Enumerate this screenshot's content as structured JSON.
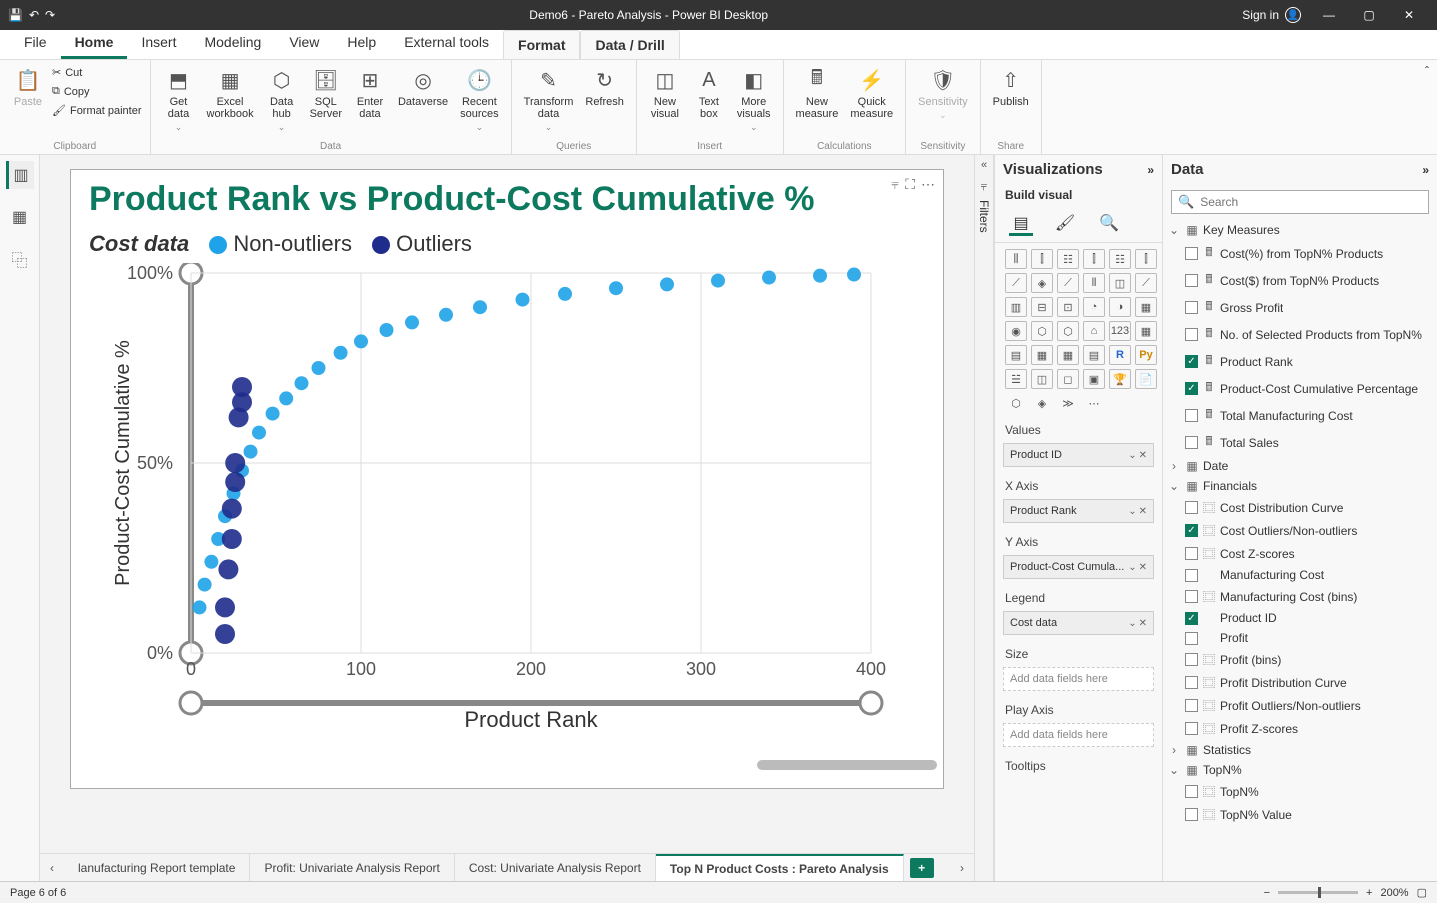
{
  "title": "Demo6 - Pareto Analysis - Power BI Desktop",
  "signin": "Sign in",
  "menutabs": [
    "File",
    "Home",
    "Insert",
    "Modeling",
    "View",
    "Help",
    "External tools",
    "Format",
    "Data / Drill"
  ],
  "activeMenu": 1,
  "selMenus": [
    7,
    8
  ],
  "ribbon": {
    "clipboard": {
      "title": "Clipboard",
      "paste": "Paste",
      "cut": "Cut",
      "copy": "Copy",
      "fmtpainter": "Format painter"
    },
    "data": {
      "title": "Data",
      "getdata": "Get\ndata",
      "excel": "Excel\nworkbook",
      "hub": "Data\nhub",
      "sql": "SQL\nServer",
      "enter": "Enter\ndata",
      "dataverse": "Dataverse",
      "recent": "Recent\nsources"
    },
    "queries": {
      "title": "Queries",
      "transform": "Transform\ndata",
      "refresh": "Refresh"
    },
    "insert": {
      "title": "Insert",
      "newvis": "New\nvisual",
      "textbox": "Text\nbox",
      "morevis": "More\nvisuals"
    },
    "calc": {
      "title": "Calculations",
      "newmeas": "New\nmeasure",
      "quick": "Quick\nmeasure"
    },
    "sens": {
      "title": "Sensitivity",
      "label": "Sensitivity"
    },
    "share": {
      "title": "Share",
      "publish": "Publish"
    }
  },
  "filtersLabel": "Filters",
  "visPane": {
    "title": "Visualizations",
    "subtitle": "Build visual",
    "wells": {
      "values": {
        "label": "Values",
        "item": "Product ID"
      },
      "xaxis": {
        "label": "X Axis",
        "item": "Product Rank"
      },
      "yaxis": {
        "label": "Y Axis",
        "item": "Product-Cost Cumula..."
      },
      "legend": {
        "label": "Legend",
        "item": "Cost data"
      },
      "size": {
        "label": "Size",
        "placeholder": "Add data fields here"
      },
      "playaxis": {
        "label": "Play Axis",
        "placeholder": "Add data fields here"
      },
      "tooltips": {
        "label": "Tooltips"
      }
    }
  },
  "dataPane": {
    "title": "Data",
    "searchPlaceholder": "Search",
    "groups": [
      {
        "name": "Key Measures",
        "open": true,
        "items": [
          {
            "label": "Cost(%) from TopN% Products",
            "icon": "m"
          },
          {
            "label": "Cost($) from TopN% Products",
            "icon": "m"
          },
          {
            "label": "Gross Profit",
            "icon": "m"
          },
          {
            "label": "No. of Selected Products from TopN%",
            "icon": "m"
          },
          {
            "label": "Product Rank",
            "icon": "m",
            "checked": true
          },
          {
            "label": "Product-Cost Cumulative Percentage",
            "icon": "m",
            "checked": true
          },
          {
            "label": "Total Manufacturing Cost",
            "icon": "m"
          },
          {
            "label": "Total Sales",
            "icon": "m"
          }
        ]
      },
      {
        "name": "Date",
        "open": false,
        "icon": "t"
      },
      {
        "name": "Financials",
        "open": true,
        "icon": "t",
        "items": [
          {
            "label": "Cost Distribution Curve",
            "icon": "g"
          },
          {
            "label": "Cost Outliers/Non-outliers",
            "icon": "g",
            "checked": true
          },
          {
            "label": "Cost Z-scores",
            "icon": "g"
          },
          {
            "label": "Manufacturing Cost",
            "icon": ""
          },
          {
            "label": "Manufacturing Cost (bins)",
            "icon": "g"
          },
          {
            "label": "Product ID",
            "icon": "",
            "checked": true
          },
          {
            "label": "Profit",
            "icon": ""
          },
          {
            "label": "Profit (bins)",
            "icon": "g"
          },
          {
            "label": "Profit Distribution Curve",
            "icon": "g"
          },
          {
            "label": "Profit Outliers/Non-outliers",
            "icon": "g"
          },
          {
            "label": "Profit Z-scores",
            "icon": "g"
          }
        ]
      },
      {
        "name": "Statistics",
        "open": false,
        "icon": "t"
      },
      {
        "name": "TopN%",
        "open": true,
        "icon": "t",
        "items": [
          {
            "label": "TopN%",
            "icon": "g"
          },
          {
            "label": "TopN% Value",
            "icon": "g"
          }
        ]
      }
    ]
  },
  "sheets": {
    "items": [
      "lanufacturing Report template",
      "Profit: Univariate Analysis Report",
      "Cost: Univariate Analysis Report",
      "Top N Product Costs : Pareto Analysis"
    ],
    "active": 3
  },
  "status": {
    "page": "Page 6 of 6",
    "zoom": "200%"
  },
  "chart_data": {
    "type": "scatter",
    "title": "Product Rank vs Product-Cost Cumulative %",
    "xlabel": "Product Rank",
    "ylabel": "Product-Cost Cumulative %",
    "legend_title": "Cost data",
    "legend": [
      "Non-outliers",
      "Outliers"
    ],
    "colors": {
      "Non-outliers": "#1fa3e8",
      "Outliers": "#1f2c8c"
    },
    "xlim": [
      0,
      400
    ],
    "ylim": [
      0,
      100
    ],
    "xticks": [
      0,
      100,
      200,
      300,
      400
    ],
    "yticks": [
      "0%",
      "50%",
      "100%"
    ],
    "series": [
      {
        "name": "Non-outliers",
        "points": [
          [
            5,
            12
          ],
          [
            8,
            18
          ],
          [
            12,
            24
          ],
          [
            16,
            30
          ],
          [
            20,
            36
          ],
          [
            25,
            42
          ],
          [
            30,
            48
          ],
          [
            35,
            53
          ],
          [
            40,
            58
          ],
          [
            48,
            63
          ],
          [
            56,
            67
          ],
          [
            65,
            71
          ],
          [
            75,
            75
          ],
          [
            88,
            79
          ],
          [
            100,
            82
          ],
          [
            115,
            85
          ],
          [
            130,
            87
          ],
          [
            150,
            89
          ],
          [
            170,
            91
          ],
          [
            195,
            93
          ],
          [
            220,
            94.5
          ],
          [
            250,
            96
          ],
          [
            280,
            97
          ],
          [
            310,
            98
          ],
          [
            340,
            98.8
          ],
          [
            370,
            99.3
          ],
          [
            390,
            99.6
          ]
        ]
      },
      {
        "name": "Outliers",
        "points": [
          [
            20,
            5
          ],
          [
            20,
            12
          ],
          [
            22,
            22
          ],
          [
            24,
            30
          ],
          [
            24,
            38
          ],
          [
            26,
            45
          ],
          [
            26,
            50
          ],
          [
            28,
            62
          ],
          [
            30,
            66
          ],
          [
            30,
            70
          ]
        ]
      }
    ]
  }
}
